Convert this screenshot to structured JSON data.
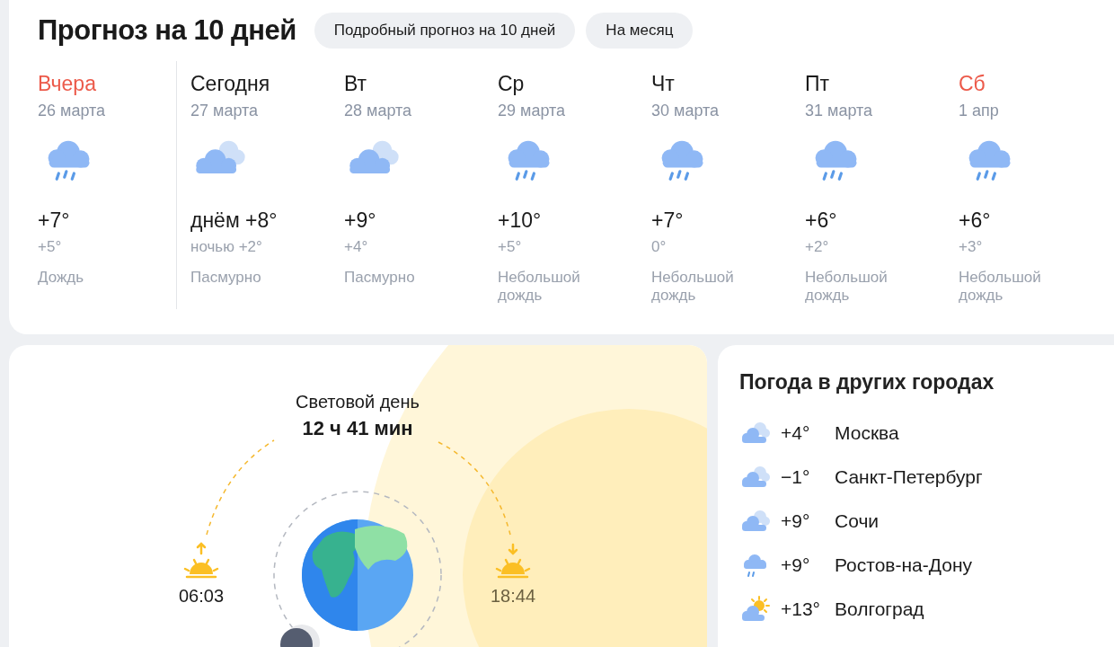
{
  "forecast": {
    "title": "Прогноз на 10 дней",
    "links": [
      {
        "label": "Подробный прогноз на 10 дней"
      },
      {
        "label": "На месяц"
      }
    ],
    "days": [
      {
        "name": "Вчера",
        "highlight": true,
        "date": "26 марта",
        "kind": "rain",
        "temp_day": "+7°",
        "temp_night": "+5°",
        "condition": "Дождь"
      },
      {
        "name": "Сегодня",
        "highlight": false,
        "date": "27 марта",
        "kind": "overcast",
        "temp_day": "днём +8°",
        "temp_night": "ночью +2°",
        "condition": "Пасмурно"
      },
      {
        "name": "Вт",
        "highlight": false,
        "date": "28 марта",
        "kind": "overcast",
        "temp_day": "+9°",
        "temp_night": "+4°",
        "condition": "Пасмурно"
      },
      {
        "name": "Ср",
        "highlight": false,
        "date": "29 марта",
        "kind": "rain",
        "temp_day": "+10°",
        "temp_night": "+5°",
        "condition": "Небольшой дождь"
      },
      {
        "name": "Чт",
        "highlight": false,
        "date": "30 марта",
        "kind": "rain",
        "temp_day": "+7°",
        "temp_night": "0°",
        "condition": "Небольшой дождь"
      },
      {
        "name": "Пт",
        "highlight": false,
        "date": "31 марта",
        "kind": "rain",
        "temp_day": "+6°",
        "temp_night": "+2°",
        "condition": "Небольшой дождь"
      },
      {
        "name": "Сб",
        "highlight": true,
        "date": "1 апр",
        "kind": "rain",
        "temp_day": "+6°",
        "temp_night": "+3°",
        "condition": "Небольшой дождь"
      }
    ]
  },
  "daylight": {
    "label": "Световой день",
    "duration": "12 ч 41 мин",
    "sunrise": "06:03",
    "sunset": "18:44"
  },
  "other_cities": {
    "title": "Погода в других городах",
    "cities": [
      {
        "kind": "overcast",
        "temp": "+4°",
        "name": "Москва"
      },
      {
        "kind": "overcast",
        "temp": "−1°",
        "name": "Санкт-Петербург"
      },
      {
        "kind": "overcast",
        "temp": "+9°",
        "name": "Сочи"
      },
      {
        "kind": "rain",
        "temp": "+9°",
        "name": "Ростов-на-Дону"
      },
      {
        "kind": "partly_sunny",
        "temp": "+13°",
        "name": "Волгоград"
      }
    ]
  }
}
